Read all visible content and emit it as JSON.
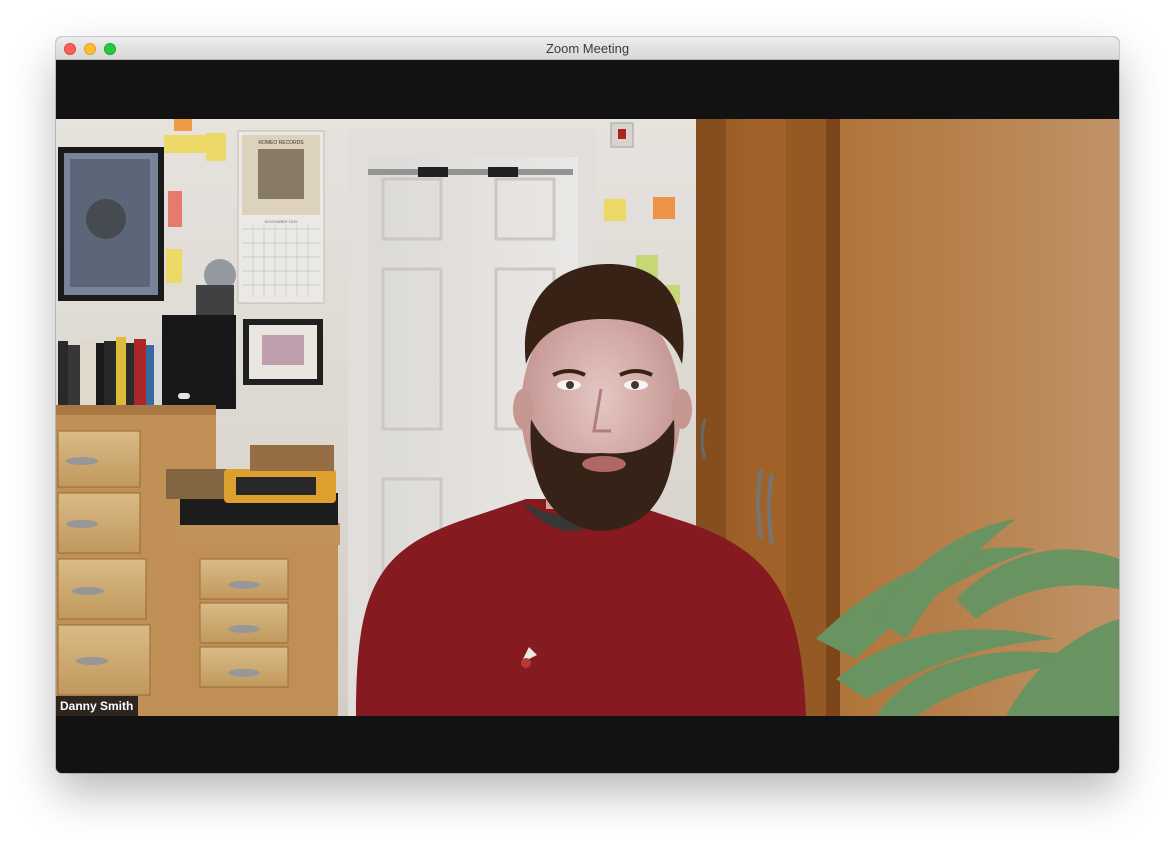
{
  "window": {
    "title": "Zoom Meeting"
  },
  "video": {
    "participant_name": "Danny Smith",
    "calendar_header": "NOVEMBER 2019"
  },
  "colors": {
    "letterbox": "#121212",
    "titlebar": "#e3e3e3",
    "close": "#fe5f57",
    "minimize": "#febc2e",
    "zoom": "#28c840",
    "sweater": "#8b1c22",
    "wardrobe": "#b77a3e"
  }
}
